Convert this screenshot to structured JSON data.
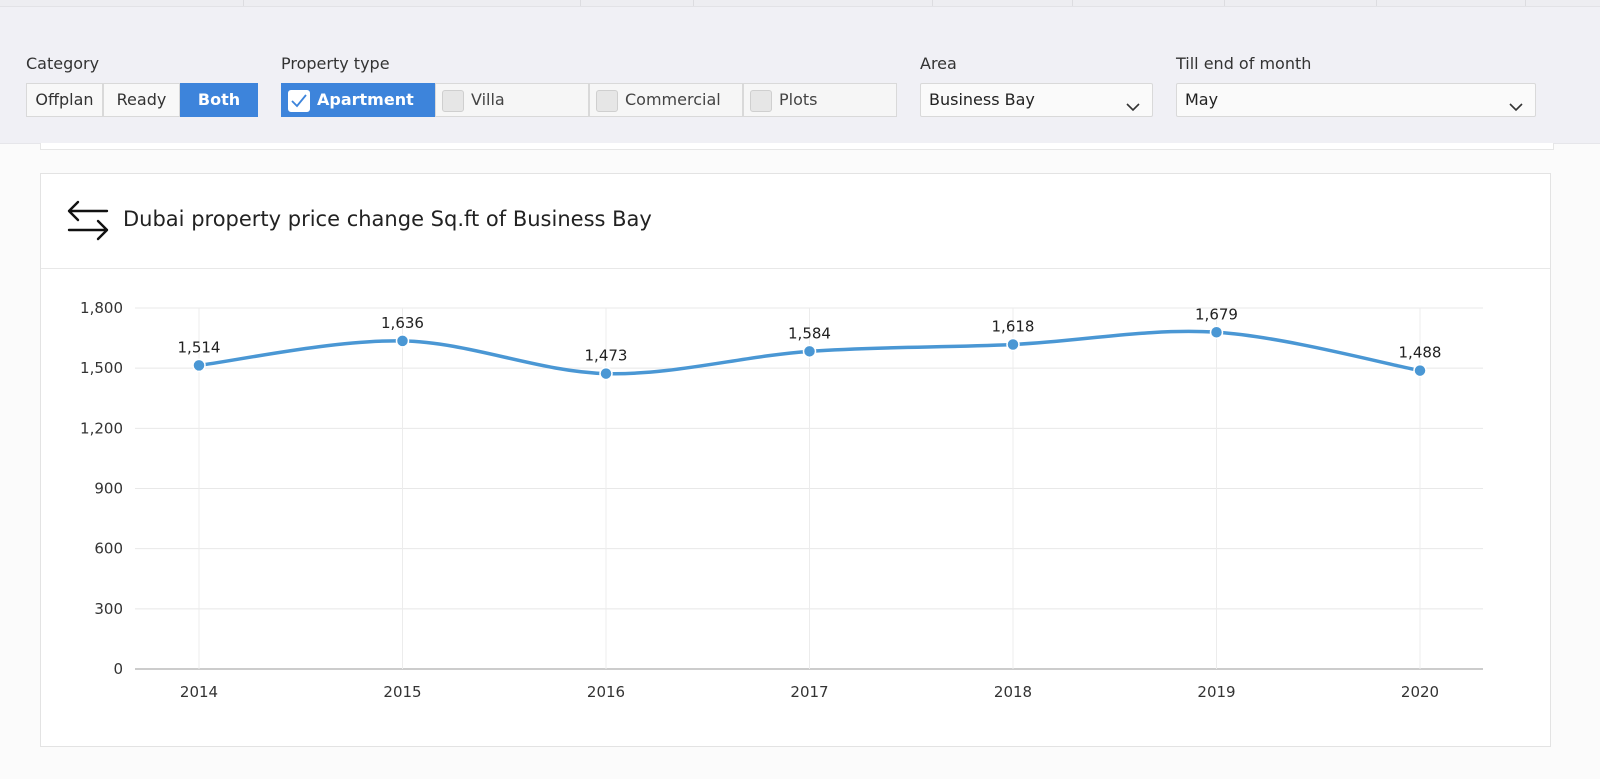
{
  "filters": {
    "category": {
      "label": "Category",
      "options": [
        "Offplan",
        "Ready",
        "Both"
      ],
      "selected": "Both"
    },
    "property_type": {
      "label": "Property type",
      "options": [
        {
          "label": "Apartment",
          "checked": true
        },
        {
          "label": "Villa",
          "checked": false
        },
        {
          "label": "Commercial",
          "checked": false
        },
        {
          "label": "Plots",
          "checked": false
        }
      ]
    },
    "area": {
      "label": "Area",
      "value": "Business Bay"
    },
    "month": {
      "label": "Till end of month",
      "value": "May"
    }
  },
  "card": {
    "title": "Dubai property price change Sq.ft of Business Bay",
    "icon": "swap-arrows-icon"
  },
  "colors": {
    "accent": "#3d84db",
    "series": "#4a97d4"
  },
  "chart_data": {
    "type": "line",
    "title": "",
    "xlabel": "",
    "ylabel": "",
    "categories": [
      "2014",
      "2015",
      "2016",
      "2017",
      "2018",
      "2019",
      "2020"
    ],
    "values": [
      1514,
      1636,
      1473,
      1584,
      1618,
      1679,
      1488
    ],
    "data_labels": [
      "1,514",
      "1,636",
      "1,473",
      "1,584",
      "1,618",
      "1,679",
      "1,488"
    ],
    "yticks": [
      "0",
      "300",
      "600",
      "900",
      "1,200",
      "1,500",
      "1,800"
    ],
    "ylim": [
      0,
      1800
    ],
    "grid": true,
    "smooth": true,
    "legend": "none"
  }
}
